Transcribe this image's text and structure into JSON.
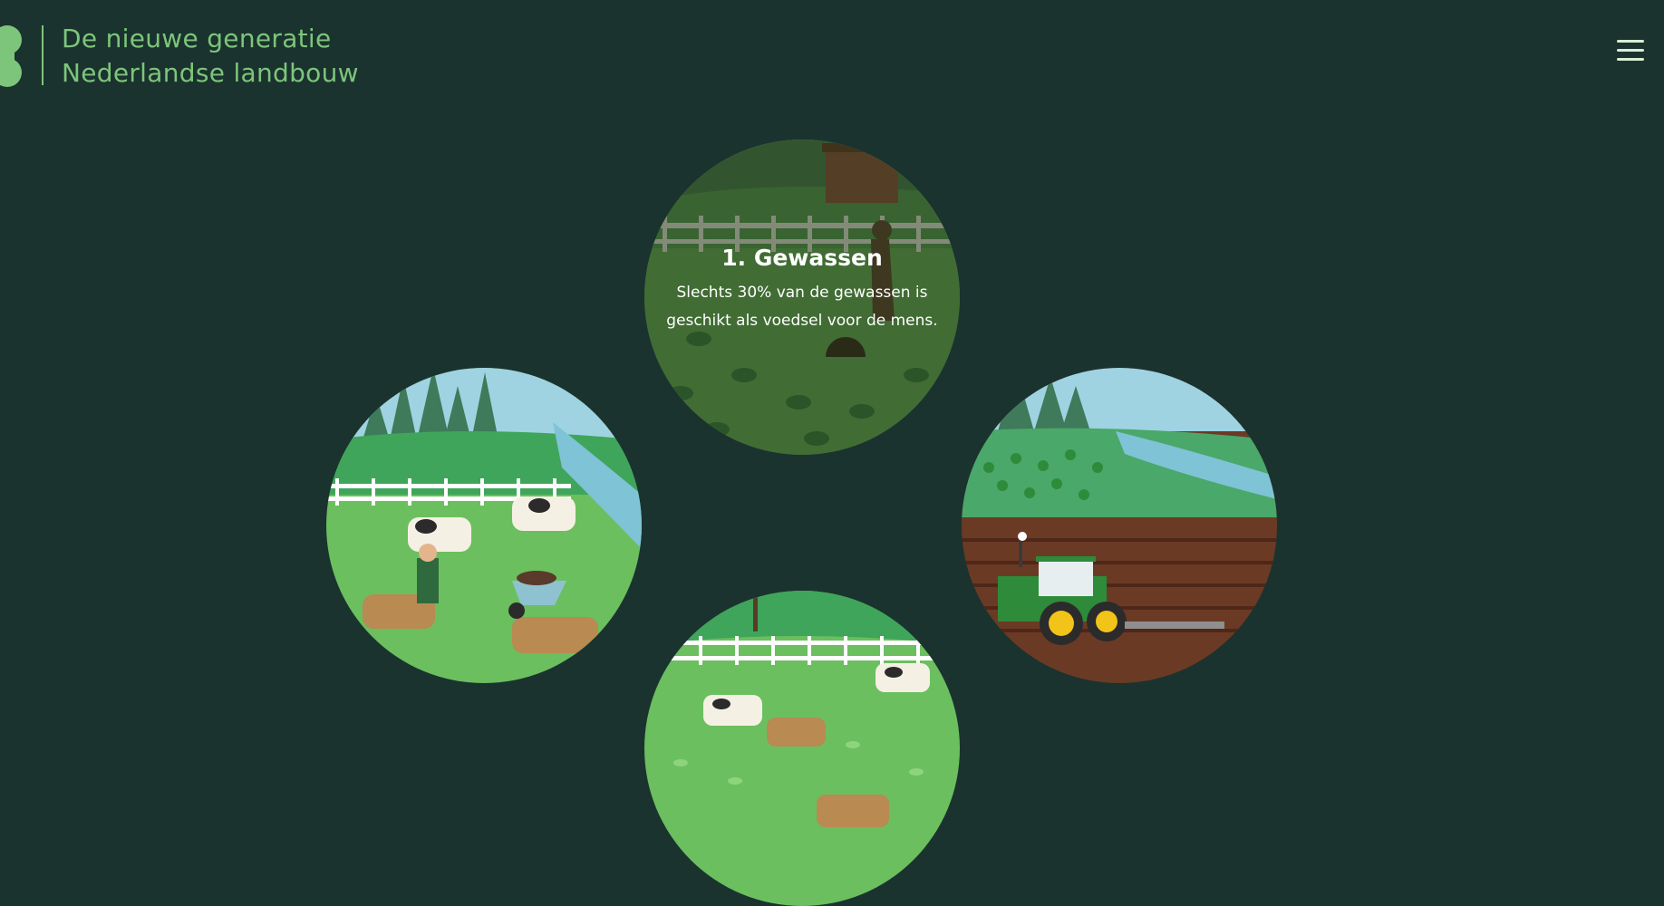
{
  "header": {
    "brand_line1": "De nieuwe generatie",
    "brand_line2": "Nederlandse landbouw",
    "menu_icon": "hamburger-menu-icon"
  },
  "colors": {
    "background": "#1b332f",
    "brand_green": "#7dc57a",
    "grass": "#6bbf5f",
    "soil": "#6b3a25",
    "tractor_green": "#2e8b3a",
    "tractor_yellow": "#f2c318"
  },
  "circles": [
    {
      "id": "gewassen",
      "title": "1. Gewassen",
      "description": "Slechts 30% van de gewassen is geschikt als voedsel voor de mens.",
      "illustration": "farmer-tending-crops"
    },
    {
      "id": "livestock-pasture",
      "illustration": "farmer-with-cows-and-wheelbarrow"
    },
    {
      "id": "tractor-field",
      "illustration": "tractor-ploughing-field"
    },
    {
      "id": "grazing-cows",
      "illustration": "cows-grazing-in-pasture"
    }
  ]
}
